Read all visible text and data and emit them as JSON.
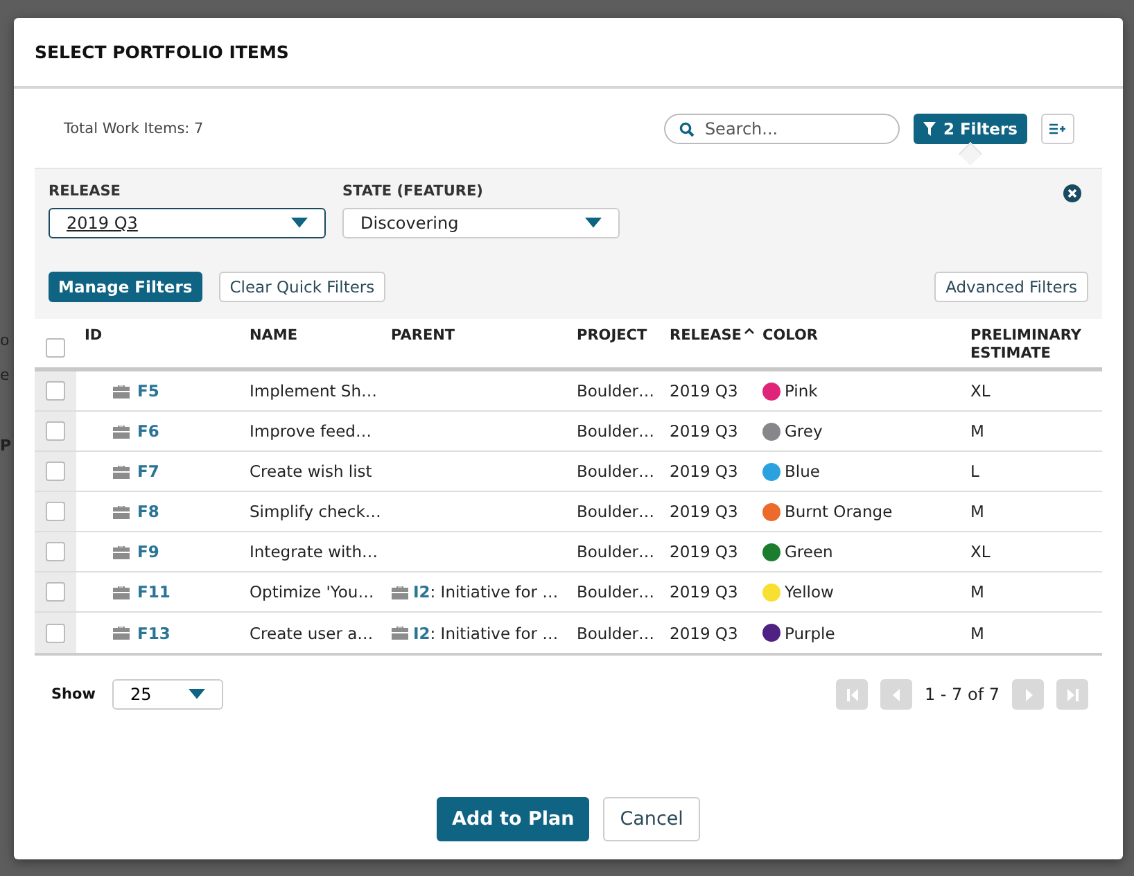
{
  "background_page": {
    "texts": [
      "o",
      "e",
      "P"
    ]
  },
  "dialog": {
    "title": "SELECT PORTFOLIO ITEMS",
    "total": "Total Work Items: 7",
    "search": {
      "placeholder": "Search..."
    },
    "filters_button": {
      "label": "2 Filters",
      "expanded": true
    },
    "filter_panel": {
      "fields": [
        {
          "label": "RELEASE",
          "value": "2019 Q3",
          "focused": true
        },
        {
          "label": "STATE (FEATURE)",
          "value": "Discovering",
          "focused": false
        }
      ],
      "manage": "Manage Filters",
      "clear": "Clear Quick Filters",
      "advanced": "Advanced Filters"
    },
    "table": {
      "columns": [
        {
          "label": "ID",
          "sorted": false
        },
        {
          "label": "NAME",
          "sorted": false
        },
        {
          "label": "PARENT",
          "sorted": false
        },
        {
          "label": "PROJECT",
          "sorted": false
        },
        {
          "label": "RELEASE",
          "sorted": true
        },
        {
          "label": "COLOR",
          "sorted": false
        },
        {
          "label": "PRELIMINARY ESTIMATE",
          "sorted": false
        }
      ],
      "all_checked": false,
      "rows": [
        {
          "checked": false,
          "id": "F5",
          "name": "Implement Sh…",
          "parent": null,
          "project": "Boulder…",
          "release": "2019 Q3",
          "color_label": "Pink",
          "color": "#e0247a",
          "estimate": "XL"
        },
        {
          "checked": false,
          "id": "F6",
          "name": "Improve feed…",
          "parent": null,
          "project": "Boulder…",
          "release": "2019 Q3",
          "color_label": "Grey",
          "color": "#86878b",
          "estimate": "M"
        },
        {
          "checked": false,
          "id": "F7",
          "name": "Create wish list",
          "parent": null,
          "project": "Boulder…",
          "release": "2019 Q3",
          "color_label": "Blue",
          "color": "#2aa2e0",
          "estimate": "L"
        },
        {
          "checked": false,
          "id": "F8",
          "name": "Simplify check…",
          "parent": null,
          "project": "Boulder…",
          "release": "2019 Q3",
          "color_label": "Burnt Orange",
          "color": "#ec6a2c",
          "estimate": "M"
        },
        {
          "checked": false,
          "id": "F9",
          "name": "Integrate with…",
          "parent": null,
          "project": "Boulder…",
          "release": "2019 Q3",
          "color_label": "Green",
          "color": "#1c7d2e",
          "estimate": "XL"
        },
        {
          "checked": false,
          "id": "F11",
          "name": "Optimize 'You…",
          "parent": {
            "id": "I2",
            "text": ": Initiative for …"
          },
          "project": "Boulder…",
          "release": "2019 Q3",
          "color_label": "Yellow",
          "color": "#f8e032",
          "estimate": "M"
        },
        {
          "checked": false,
          "id": "F13",
          "name": "Create user a…",
          "parent": {
            "id": "I2",
            "text": ": Initiative for …"
          },
          "project": "Boulder…",
          "release": "2019 Q3",
          "color_label": "Purple",
          "color": "#4e2182",
          "estimate": "M"
        }
      ]
    },
    "footer": {
      "show_label": "Show",
      "page_size": "25",
      "range": "1 - 7 of 7",
      "first_disabled": true,
      "prev_disabled": true,
      "next_disabled": true,
      "last_disabled": true
    },
    "actions": {
      "primary": "Add to Plan",
      "cancel": "Cancel"
    }
  }
}
